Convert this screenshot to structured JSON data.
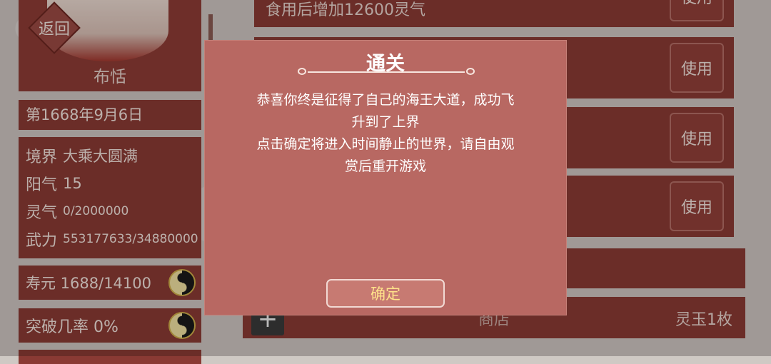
{
  "left_panel": {
    "back_label": "返回",
    "character_name": "布恬",
    "date": "第1668年9月6日",
    "stats": [
      {
        "label": "境界",
        "value": "大乘大圆满"
      },
      {
        "label": "阳气",
        "value": "15"
      },
      {
        "label": "灵气",
        "value": "0/2000000"
      },
      {
        "label": "武力",
        "value": "553177633/34880000"
      }
    ],
    "lifespan": "寿元 1688/14100",
    "breakthrough": "突破几率 0%"
  },
  "items": [
    {
      "desc": "食用后增加12600灵气",
      "use_label": "使用"
    },
    {
      "desc": "",
      "use_label": "使用"
    },
    {
      "desc": "",
      "use_label": "使用"
    },
    {
      "desc": "",
      "use_label": "使用"
    }
  ],
  "shop": {
    "plus_label": "+",
    "shop_label": "商店",
    "spirit_stone": "灵玉1枚"
  },
  "dialog": {
    "title": "通关",
    "body_line1": "恭喜你终是征得了自己的海王大道，成功飞",
    "body_line2": "升到了上界",
    "body_line3": "点击确定将进入时间静止的世界，请自由观",
    "body_line4": "赏后重开游戏",
    "confirm_label": "确定"
  },
  "colors": {
    "panel": "#8a3a34",
    "dialog": "#b86862",
    "confirm_text": "#ffe38a"
  }
}
